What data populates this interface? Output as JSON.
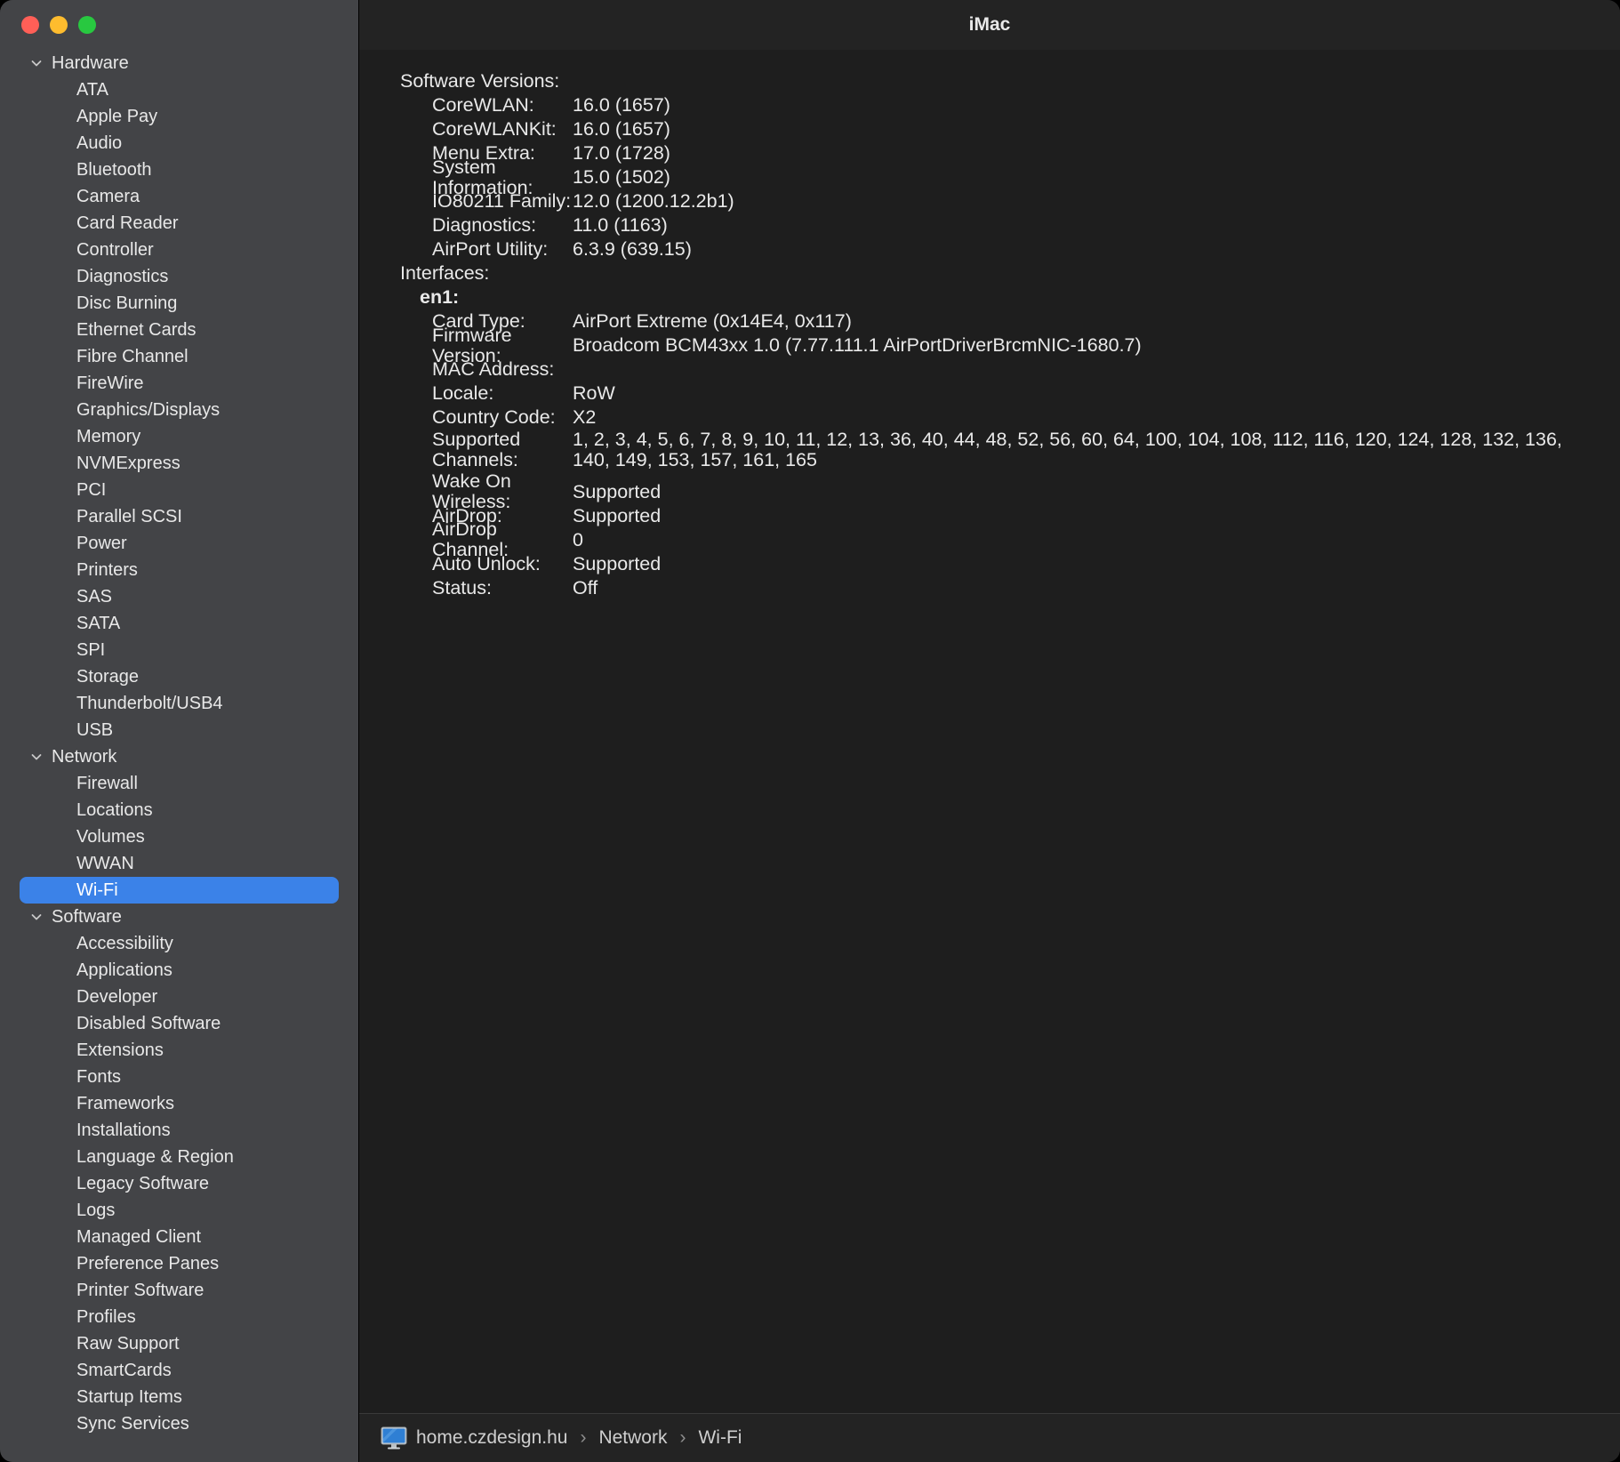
{
  "window": {
    "title": "iMac",
    "traffic_lights": [
      {
        "name": "close",
        "color": "#ff5f57"
      },
      {
        "name": "minimize",
        "color": "#febc2e"
      },
      {
        "name": "zoom",
        "color": "#28c840"
      }
    ]
  },
  "sidebar": {
    "selected": "Wi-Fi",
    "accent_color": "#3b82e8",
    "groups": [
      {
        "label": "Hardware",
        "expanded": true,
        "items": [
          "ATA",
          "Apple Pay",
          "Audio",
          "Bluetooth",
          "Camera",
          "Card Reader",
          "Controller",
          "Diagnostics",
          "Disc Burning",
          "Ethernet Cards",
          "Fibre Channel",
          "FireWire",
          "Graphics/Displays",
          "Memory",
          "NVMExpress",
          "PCI",
          "Parallel SCSI",
          "Power",
          "Printers",
          "SAS",
          "SATA",
          "SPI",
          "Storage",
          "Thunderbolt/USB4",
          "USB"
        ]
      },
      {
        "label": "Network",
        "expanded": true,
        "items": [
          "Firewall",
          "Locations",
          "Volumes",
          "WWAN",
          "Wi-Fi"
        ]
      },
      {
        "label": "Software",
        "expanded": true,
        "items": [
          "Accessibility",
          "Applications",
          "Developer",
          "Disabled Software",
          "Extensions",
          "Fonts",
          "Frameworks",
          "Installations",
          "Language & Region",
          "Legacy Software",
          "Logs",
          "Managed Client",
          "Preference Panes",
          "Printer Software",
          "Profiles",
          "Raw Support",
          "SmartCards",
          "Startup Items",
          "Sync Services"
        ]
      }
    ]
  },
  "content": {
    "software_versions_heading": "Software Versions:",
    "software_versions": [
      {
        "key": "CoreWLAN:",
        "value": "16.0 (1657)"
      },
      {
        "key": "CoreWLANKit:",
        "value": "16.0 (1657)"
      },
      {
        "key": "Menu Extra:",
        "value": "17.0 (1728)"
      },
      {
        "key": "System Information:",
        "value": "15.0 (1502)"
      },
      {
        "key": "IO80211 Family:",
        "value": "12.0 (1200.12.2b1)"
      },
      {
        "key": "Diagnostics:",
        "value": "11.0 (1163)"
      },
      {
        "key": "AirPort Utility:",
        "value": "6.3.9 (639.15)"
      }
    ],
    "interfaces_heading": "Interfaces:",
    "interface_name": "en1:",
    "interface_fields": [
      {
        "key": "Card Type:",
        "value": "AirPort Extreme  (0x14E4, 0x117)"
      },
      {
        "key": "Firmware Version:",
        "value": "Broadcom BCM43xx 1.0 (7.77.111.1 AirPortDriverBrcmNIC-1680.7)"
      },
      {
        "key": "MAC Address:",
        "value": ""
      },
      {
        "key": "Locale:",
        "value": "RoW"
      },
      {
        "key": "Country Code:",
        "value": "X2"
      }
    ],
    "supported_channels_key": "Supported Channels:",
    "supported_channels_value": "1, 2, 3, 4, 5, 6, 7, 8, 9, 10, 11, 12, 13, 36, 40, 44, 48, 52, 56, 60, 64, 100, 104, 108, 112, 116, 120, 124, 128, 132, 136, 140, 149, 153, 157, 161, 165",
    "interface_fields_2": [
      {
        "key": "Wake On Wireless:",
        "value": "Supported"
      },
      {
        "key": "AirDrop:",
        "value": "Supported"
      },
      {
        "key": "AirDrop Channel:",
        "value": "0"
      },
      {
        "key": "Auto Unlock:",
        "value": "Supported"
      },
      {
        "key": "Status:",
        "value": "Off"
      }
    ]
  },
  "statusbar": {
    "icon": "imac-display-icon",
    "crumb1": "home.czdesign.hu",
    "sep1": "›",
    "crumb2": "Network",
    "sep2": "›",
    "crumb3": "Wi-Fi"
  }
}
